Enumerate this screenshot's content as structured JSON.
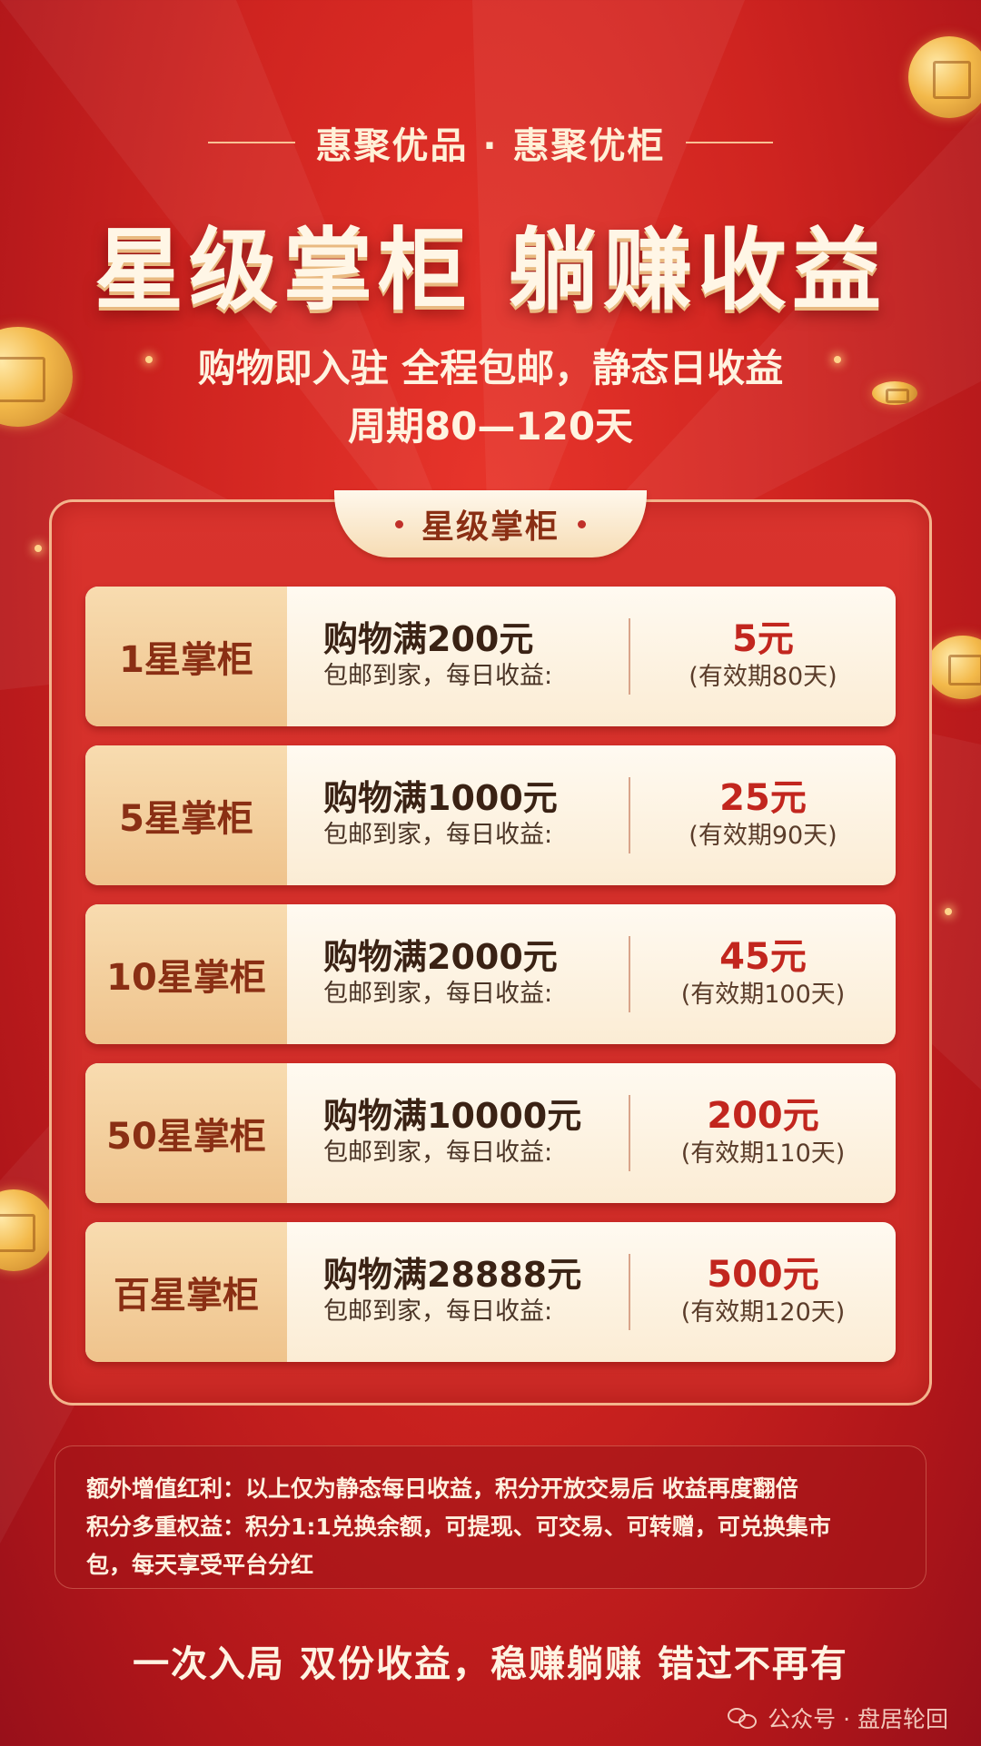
{
  "header": {
    "brand": "惠聚优品 · 惠聚优柜",
    "title": "星级掌柜 躺赚收益",
    "subtitle_line1": "购物即入驻 全程包邮，静态日收益",
    "subtitle_line2": "周期80—120天"
  },
  "panel": {
    "tab_label": "星级掌柜",
    "tiers": [
      {
        "level": "1星掌柜",
        "condition": "购物满200元",
        "desc": "包邮到家，每日收益:",
        "amount": "5元",
        "validity": "(有效期80天)"
      },
      {
        "level": "5星掌柜",
        "condition": "购物满1000元",
        "desc": "包邮到家，每日收益:",
        "amount": "25元",
        "validity": "(有效期90天)"
      },
      {
        "level": "10星掌柜",
        "condition": "购物满2000元",
        "desc": "包邮到家，每日收益:",
        "amount": "45元",
        "validity": "(有效期100天)"
      },
      {
        "level": "50星掌柜",
        "condition": "购物满10000元",
        "desc": "包邮到家，每日收益:",
        "amount": "200元",
        "validity": "(有效期110天)"
      },
      {
        "level": "百星掌柜",
        "condition": "购物满28888元",
        "desc": "包邮到家，每日收益:",
        "amount": "500元",
        "validity": "(有效期120天)"
      }
    ]
  },
  "bonus": {
    "line1": "额外增值红利：以上仅为静态每日收益，积分开放交易后 收益再度翻倍",
    "line2": "积分多重权益：积分1:1兑换余额，可提现、可交易、可转赠，可兑换集市",
    "line3": "包，每天享受平台分红"
  },
  "footer": {
    "slogan": "一次入局 双份收益，稳赚躺赚 错过不再有",
    "watermark": "公众号 · 盘居轮回"
  },
  "colors": {
    "background": "#cf2420",
    "accent_gold": "#f3b94a",
    "amount_red": "#c2261e",
    "level_cell": "#efc38c"
  }
}
